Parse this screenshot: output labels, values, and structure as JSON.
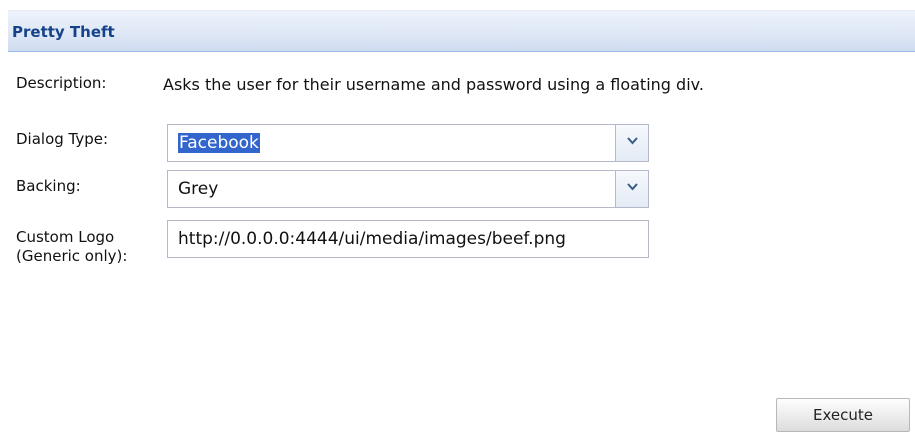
{
  "panel": {
    "title": "Pretty Theft"
  },
  "form": {
    "description": {
      "label": "Description:",
      "text": "Asks the user for their username and password using a floating div."
    },
    "dialog_type": {
      "label": "Dialog Type:",
      "value": "Facebook"
    },
    "backing": {
      "label": "Backing:",
      "value": "Grey"
    },
    "custom_logo": {
      "label_line1": "Custom Logo",
      "label_line2": "(Generic only):",
      "value": "http://0.0.0.0:4444/ui/media/images/beef.png"
    }
  },
  "actions": {
    "execute_label": "Execute"
  },
  "colors": {
    "header_text": "#15428b",
    "selection": "#3366cc",
    "field_border": "#b5b8c8"
  },
  "icons": {
    "dropdown": "chevron-down-icon"
  }
}
